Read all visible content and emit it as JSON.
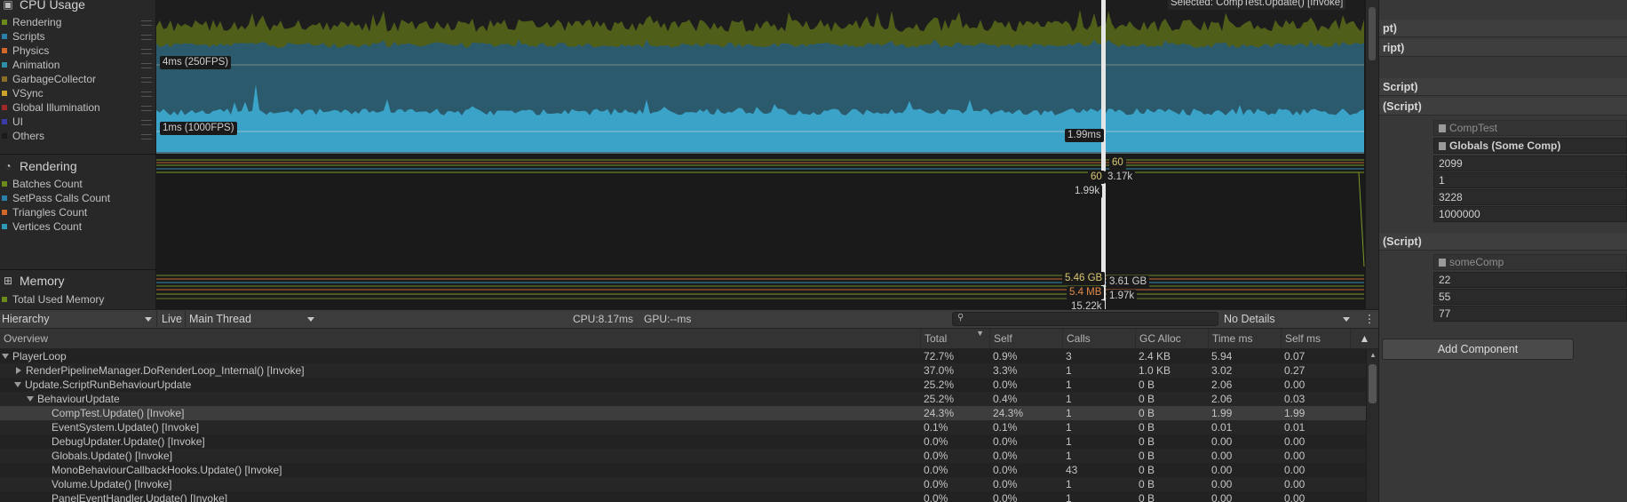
{
  "modules": {
    "cpu": {
      "title": "CPU Usage",
      "legend": [
        {
          "label": "Rendering",
          "color": "#6c8a1c"
        },
        {
          "label": "Scripts",
          "color": "#2c7fa8"
        },
        {
          "label": "Physics",
          "color": "#d0682a"
        },
        {
          "label": "Animation",
          "color": "#2f8fa6"
        },
        {
          "label": "GarbageCollector",
          "color": "#8a6f28"
        },
        {
          "label": "VSync",
          "color": "#c9a22a"
        },
        {
          "label": "Global Illumination",
          "color": "#a02a2a"
        },
        {
          "label": "UI",
          "color": "#3c3ca8"
        },
        {
          "label": "Others",
          "color": "#1a1a1a"
        }
      ],
      "tags": {
        "line4ms": "4ms (250FPS)",
        "line1ms": "1ms (1000FPS)",
        "cursor": "1.99ms",
        "selected": "Selected: CompTest.Update() [Invoke]"
      }
    },
    "rendering": {
      "title": "Rendering",
      "legend": [
        {
          "label": "Batches Count",
          "color": "#6c8a1c"
        },
        {
          "label": "SetPass Calls Count",
          "color": "#2c7fa8"
        },
        {
          "label": "Triangles Count",
          "color": "#d0682a"
        },
        {
          "label": "Vertices Count",
          "color": "#2f9ab5"
        }
      ],
      "tags": {
        "a": "60",
        "b": "60",
        "c": "3.17k",
        "d": "1.99k"
      }
    },
    "memory": {
      "title": "Memory",
      "legend": [
        {
          "label": "Total Used Memory",
          "color": "#6c8a1c"
        }
      ],
      "tags": {
        "a": "5.46 GB",
        "b": "3.61 GB",
        "c": "5.4 MB",
        "d": "1.97k",
        "e": "15.22k"
      }
    }
  },
  "toolbar": {
    "view": "Hierarchy",
    "live": "Live",
    "thread": "Main Thread",
    "cpu": "CPU:8.17ms",
    "gpu": "GPU:--ms",
    "details": "No Details",
    "more": "⋮"
  },
  "table": {
    "headers": [
      "Overview",
      "Total",
      "Self",
      "Calls",
      "GC Alloc",
      "Time ms",
      "Self ms"
    ],
    "rows": [
      {
        "name": "PlayerLoop",
        "indent": 0,
        "expand": "down",
        "total": "72.7%",
        "self": "0.9%",
        "calls": "3",
        "gc": "2.4 KB",
        "time": "5.94",
        "selfms": "0.07"
      },
      {
        "name": "RenderPipelineManager.DoRenderLoop_Internal() [Invoke]",
        "indent": 1,
        "expand": "right",
        "total": "37.0%",
        "self": "3.3%",
        "calls": "1",
        "gc": "1.0 KB",
        "time": "3.02",
        "selfms": "0.27"
      },
      {
        "name": "Update.ScriptRunBehaviourUpdate",
        "indent": 1,
        "expand": "down",
        "total": "25.2%",
        "self": "0.0%",
        "calls": "1",
        "gc": "0 B",
        "time": "2.06",
        "selfms": "0.00"
      },
      {
        "name": "BehaviourUpdate",
        "indent": 2,
        "expand": "down",
        "total": "25.2%",
        "self": "0.4%",
        "calls": "1",
        "gc": "0 B",
        "time": "2.06",
        "selfms": "0.03"
      },
      {
        "name": "CompTest.Update() [Invoke]",
        "indent": 4,
        "expand": "none",
        "total": "24.3%",
        "self": "24.3%",
        "calls": "1",
        "gc": "0 B",
        "time": "1.99",
        "selfms": "1.99",
        "selected": true
      },
      {
        "name": "EventSystem.Update() [Invoke]",
        "indent": 4,
        "expand": "none",
        "total": "0.1%",
        "self": "0.1%",
        "calls": "1",
        "gc": "0 B",
        "time": "0.01",
        "selfms": "0.01"
      },
      {
        "name": "DebugUpdater.Update() [Invoke]",
        "indent": 4,
        "expand": "none",
        "total": "0.0%",
        "self": "0.0%",
        "calls": "1",
        "gc": "0 B",
        "time": "0.00",
        "selfms": "0.00"
      },
      {
        "name": "Globals.Update() [Invoke]",
        "indent": 4,
        "expand": "none",
        "total": "0.0%",
        "self": "0.0%",
        "calls": "1",
        "gc": "0 B",
        "time": "0.00",
        "selfms": "0.00"
      },
      {
        "name": "MonoBehaviourCallbackHooks.Update() [Invoke]",
        "indent": 4,
        "expand": "none",
        "total": "0.0%",
        "self": "0.0%",
        "calls": "43",
        "gc": "0 B",
        "time": "0.00",
        "selfms": "0.00"
      },
      {
        "name": "Volume.Update() [Invoke]",
        "indent": 4,
        "expand": "none",
        "total": "0.0%",
        "self": "0.0%",
        "calls": "1",
        "gc": "0 B",
        "time": "0.00",
        "selfms": "0.00"
      },
      {
        "name": "PanelEventHandler.Update() [Invoke]",
        "indent": 4,
        "expand": "none",
        "total": "0.0%",
        "self": "0.0%",
        "calls": "1",
        "gc": "0 B",
        "time": "0.00",
        "selfms": "0.00"
      }
    ]
  },
  "inspector": {
    "headers": [
      "pt)",
      "ript)",
      "Script)",
      "(Script)"
    ],
    "comp1": {
      "script": "CompTest",
      "ref": "Globals (Some Comp)",
      "values": [
        "2099",
        "1",
        "3228",
        "1000000"
      ]
    },
    "header2": "(Script)",
    "comp2": {
      "script": "someComp",
      "values": [
        "22",
        "55",
        "77"
      ]
    },
    "add_component": "Add Component"
  }
}
